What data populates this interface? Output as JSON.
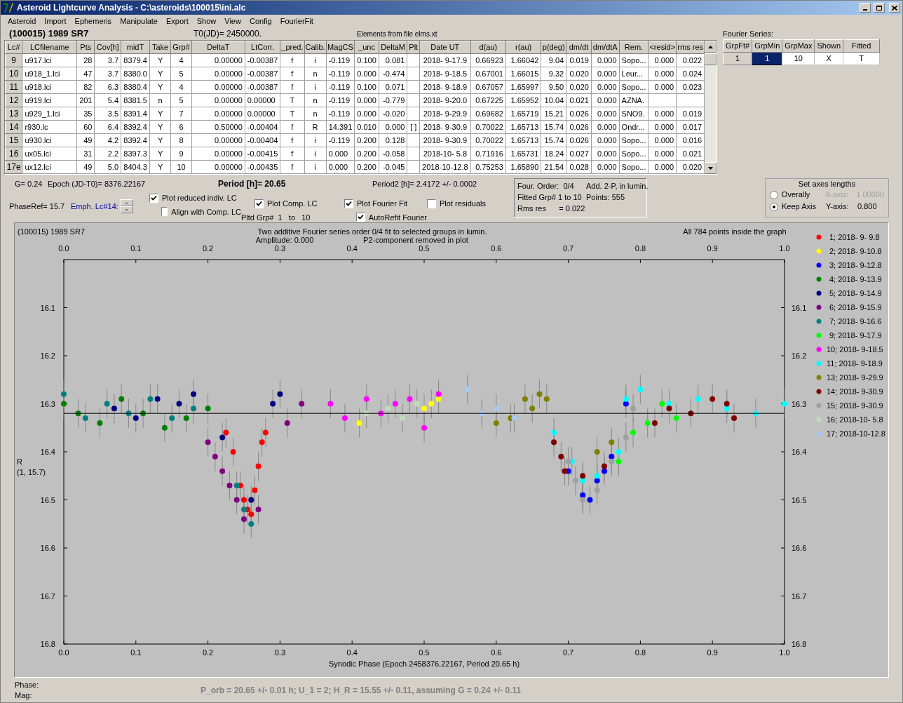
{
  "window": {
    "title": "Asteroid Lightcurve Analysis - C:\\asteroids\\100015\\ini.alc"
  },
  "menu": [
    "Asteroid",
    "Import",
    "Ephemeris",
    "Manipulate",
    "Export",
    "Show",
    "View",
    "Config",
    "FourierFit"
  ],
  "header": {
    "object": "(100015) 1989 SR7",
    "t0": "T0(JD)= 2450000.",
    "elements": "Elements from file elms.xt"
  },
  "table": {
    "columns": [
      "Lc#",
      "LCfilename",
      "Pts",
      "Cov[h]",
      "midT",
      "Take",
      "Grp#",
      "DeltaT",
      "LtCorr.",
      "_pred.",
      "Calib.",
      "MagCS",
      "_unc",
      "DeltaM",
      "Plt",
      "Date UT",
      "d(au)",
      "r(au)",
      "p(deg)",
      "dm/dt",
      "dm/dtA",
      "Rem.",
      "<resid>",
      "rms res"
    ],
    "rows": [
      {
        "cells": [
          "9",
          "u917.lci",
          "28",
          "3.7",
          "8379.4",
          "Y",
          "4",
          "0.00000",
          "-0.00387",
          "f",
          "i",
          "-0.119",
          "0.100",
          "0.081",
          null,
          "2018- 9-17.9",
          "0.66923",
          "1.66042",
          "9.04",
          "0.019",
          "0.000",
          "Sopo...",
          "0.000",
          "0.022"
        ]
      },
      {
        "cells": [
          "10",
          "u918_1.lci",
          "47",
          "3.7",
          "8380.0",
          "Y",
          "5",
          "0.00000",
          "-0.00387",
          "f",
          "n",
          "-0.119",
          "0.000",
          "-0.474",
          null,
          "2018- 9-18.5",
          "0.67001",
          "1.66015",
          "9.32",
          "0.020",
          "0.000",
          "Leur...",
          "0.000",
          "0.024"
        ]
      },
      {
        "cells": [
          "11",
          "u918.lci",
          "82",
          "6.3",
          "8380.4",
          "Y",
          "4",
          "0.00000",
          "-0.00387",
          "f",
          "i",
          "-0.119",
          "0.100",
          "0.071",
          null,
          "2018- 9-18.9",
          "0.67057",
          "1.65997",
          "9.50",
          "0.020",
          "0.000",
          "Sopo...",
          "0.000",
          "0.023"
        ]
      },
      {
        "cells": [
          "12",
          "u919.lci",
          "201",
          "5.4",
          "8381.5",
          "n",
          "5",
          "0.00000",
          "0.00000",
          "T",
          "n",
          "-0.119",
          "0.000",
          "-0.779",
          null,
          "2018- 9-20.0",
          "0.67225",
          "1.65952",
          "10.04",
          "0.021",
          "0.000",
          "AZNA.",
          null,
          null
        ]
      },
      {
        "cells": [
          "13",
          "u929_1.lci",
          "35",
          "3.5",
          "8391.4",
          "Y",
          "7",
          "0.00000",
          "0.00000",
          "T",
          "n",
          "-0.119",
          "0.000",
          "-0.020",
          null,
          "2018- 9-29.9",
          "0.69682",
          "1.65719",
          "15.21",
          "0.026",
          "0.000",
          "SNO9.",
          "0.000",
          "0.019"
        ]
      },
      {
        "cells": [
          "14",
          "r930.lc",
          "60",
          "6.4",
          "8392.4",
          "Y",
          "6",
          "0.50000",
          "-0.00404",
          "f",
          "R",
          "14.391",
          "0.010",
          "0.000",
          "[ ]",
          "2018- 9-30.9",
          "0.70022",
          "1.65713",
          "15.74",
          "0.026",
          "0.000",
          "Ondr...",
          "0.000",
          "0.017"
        ]
      },
      {
        "cells": [
          "15",
          "u930.lci",
          "49",
          "4.2",
          "8392.4",
          "Y",
          "8",
          "0.00000",
          "-0.00404",
          "f",
          "i",
          "-0.119",
          "0.200",
          "0.128",
          null,
          "2018- 9-30.9",
          "0.70022",
          "1.65713",
          "15.74",
          "0.026",
          "0.000",
          "Sopo...",
          "0.000",
          "0.016"
        ]
      },
      {
        "cells": [
          "16",
          "ux05.lci",
          "31",
          "2.2",
          "8397.3",
          "Y",
          "9",
          "0.00000",
          "-0.00415",
          "f",
          "i",
          "0.000",
          "0.200",
          "-0.058",
          null,
          "2018-10- 5.8",
          "0.71916",
          "1.65731",
          "18.24",
          "0.027",
          "0.000",
          "Sopo...",
          "0.000",
          "0.021"
        ]
      },
      {
        "cells": [
          "17e",
          "ux12.lci",
          "49",
          "5.0",
          "8404.3",
          "Y",
          "10",
          "0.00000",
          "-0.00435",
          "f",
          "i",
          "0.000",
          "0.200",
          "-0.045",
          null,
          "2018-10-12.8",
          "0.75253",
          "1.65890",
          "21.54",
          "0.028",
          "0.000",
          "Sopo...",
          "0.000",
          "0.020"
        ]
      }
    ]
  },
  "fourier": {
    "label": "Fourier Series:",
    "columns": [
      "GrpFt#",
      "GrpMin",
      "GrpMax",
      "Shown",
      "Fitted"
    ],
    "row": [
      {
        "text": "1",
        "selected": false
      },
      {
        "text": "1",
        "selected": true
      },
      {
        "text": "10",
        "selected": false
      },
      {
        "text": "X",
        "selected": false
      },
      {
        "text": "T",
        "selected": false
      }
    ]
  },
  "params": {
    "g": "G= 0.24",
    "epoch": "Epoch (JD-T0)= 8376.22167",
    "period": "Period [h]= 20.65",
    "period2": "Period2 [h]= 2.4172 +/- 0.0002",
    "phase_ref": "PhaseRef= 15.7",
    "emph": "Emph. Lc#14:",
    "pltd_grp": "Pltd Grp#  1   to   10"
  },
  "checkboxes": [
    {
      "label": "Plot reduced indiv. LC",
      "checked": true
    },
    {
      "label": "Align with Comp. LC",
      "checked": false
    },
    {
      "label": "Plot Comp. LC",
      "checked": true
    },
    {
      "label": "Plot Fourier Fit",
      "checked": true
    },
    {
      "label": "AutoRefit Fourier",
      "checked": true
    },
    {
      "label": "Plot residuals",
      "checked": false
    }
  ],
  "fit_info": [
    "Four. Order:  0/4",
    "Add. 2-P, in lumin.",
    "Fitted Grp# 1 to 10",
    "Points: 555",
    "Rms res      = 0.022"
  ],
  "axes": {
    "title": "Set axes lengths",
    "options": [
      {
        "label": "Overally",
        "selected": false
      },
      {
        "label": "Keep Axis",
        "selected": true
      }
    ],
    "fields": [
      {
        "label": "X-axis:",
        "value": "1.00000",
        "disabled": true
      },
      {
        "label": "Y-axis:",
        "value": "0.800",
        "disabled": false
      }
    ]
  },
  "plot": {
    "object": "(100015) 1989 SR7",
    "subtitle_left": "Amplitude: 0.000",
    "subtitle_right": "P2-component removed in plot",
    "points_note": "All 784 points inside the graph",
    "y_note": "(1, 15.7)",
    "chart_data": {
      "type": "scatter",
      "title": "Two additive Fourier series order 0/4 fit to selected groups in lumin.",
      "xlabel": "Synodic Phase (Epoch 2458376.22167, Period 20.65 h)",
      "ylabel": "R",
      "xlim": [
        0,
        1
      ],
      "ylim": [
        16.8,
        16.0
      ],
      "xticks": [
        {
          "value": 0,
          "label": "0.0"
        },
        {
          "value": 0.1,
          "label": "0.1"
        },
        {
          "value": 0.2,
          "label": "0.2"
        },
        {
          "value": 0.3,
          "label": "0.3"
        },
        {
          "value": 0.4,
          "label": "0.4"
        },
        {
          "value": 0.5,
          "label": "0.5"
        },
        {
          "value": 0.6,
          "label": "0.6"
        },
        {
          "value": 0.7,
          "label": "0.7"
        },
        {
          "value": 0.8,
          "label": "0.8"
        },
        {
          "value": 0.9,
          "label": "0.9"
        },
        {
          "value": 1,
          "label": "1.0"
        }
      ],
      "yticks": [
        {
          "value": 16.1,
          "label": "16.1"
        },
        {
          "value": 16.2,
          "label": "16.2"
        },
        {
          "value": 16.3,
          "label": "16.3"
        },
        {
          "value": 16.4,
          "label": "16.4"
        },
        {
          "value": 16.5,
          "label": "16.5"
        },
        {
          "value": 16.6,
          "label": "16.6"
        },
        {
          "value": 16.7,
          "label": "16.7"
        },
        {
          "value": 16.8,
          "label": "16.8"
        }
      ],
      "ref_lines": [
        {
          "axis": "y",
          "value": 16.32
        }
      ],
      "legend": true,
      "series": [
        {
          "name": "1; 2018- 9- 9.8",
          "color": "#ff0000",
          "x": [
            0.225,
            0.235,
            0.245,
            0.25,
            0.255,
            0.26,
            0.265,
            0.27,
            0.275,
            0.28
          ],
          "values": [
            16.36,
            16.4,
            16.47,
            16.5,
            16.52,
            16.53,
            16.48,
            16.43,
            16.38,
            16.36
          ],
          "errors": [
            0.03,
            0.03,
            0.03,
            0.03,
            0.03,
            0.03,
            0.03,
            0.03,
            0.03,
            0.03
          ]
        },
        {
          "name": "2; 2018- 9-10.8",
          "color": "#ffff00",
          "x": [
            0.41,
            0.5,
            0.51,
            0.52
          ],
          "values": [
            16.34,
            16.31,
            16.3,
            16.29
          ],
          "errors": [
            0.03,
            0.03,
            0.03,
            0.03
          ]
        },
        {
          "name": "3; 2018- 9-12.8",
          "color": "#0000ff",
          "x": [
            0.7,
            0.72,
            0.73,
            0.74,
            0.75,
            0.76,
            0.78
          ],
          "values": [
            16.44,
            16.49,
            16.5,
            16.46,
            16.44,
            16.41,
            16.3
          ],
          "errors": [
            0.03,
            0.03,
            0.03,
            0.03,
            0.03,
            0.03,
            0.03
          ]
        },
        {
          "name": "4; 2018- 9-13.9",
          "color": "#008000",
          "x": [
            0.0,
            0.02,
            0.05,
            0.08,
            0.11,
            0.14,
            0.17,
            0.2
          ],
          "values": [
            16.3,
            16.32,
            16.34,
            16.29,
            16.32,
            16.35,
            16.33,
            16.31
          ],
          "errors": [
            0.03,
            0.03,
            0.03,
            0.03,
            0.03,
            0.03,
            0.03,
            0.03
          ]
        },
        {
          "name": "5; 2018- 9-14.9",
          "color": "#000080",
          "x": [
            0.07,
            0.1,
            0.13,
            0.16,
            0.18,
            0.22,
            0.26,
            0.29,
            0.3
          ],
          "values": [
            16.31,
            16.33,
            16.29,
            16.3,
            16.28,
            16.37,
            16.5,
            16.3,
            16.28
          ],
          "errors": [
            0.03,
            0.03,
            0.03,
            0.03,
            0.03,
            0.03,
            0.03,
            0.03,
            0.03
          ]
        },
        {
          "name": "6; 2018- 9-15.9",
          "color": "#800080",
          "x": [
            0.2,
            0.21,
            0.22,
            0.23,
            0.24,
            0.25,
            0.27,
            0.31,
            0.33
          ],
          "values": [
            16.38,
            16.41,
            16.44,
            16.47,
            16.5,
            16.54,
            16.52,
            16.34,
            16.3
          ],
          "errors": [
            0.03,
            0.03,
            0.03,
            0.03,
            0.03,
            0.03,
            0.03,
            0.03,
            0.03
          ]
        },
        {
          "name": "7; 2018- 9-16.6",
          "color": "#008080",
          "x": [
            0.0,
            0.03,
            0.06,
            0.09,
            0.12,
            0.15,
            0.18,
            0.24,
            0.25,
            0.26
          ],
          "values": [
            16.28,
            16.33,
            16.3,
            16.32,
            16.29,
            16.33,
            16.31,
            16.47,
            16.52,
            16.55
          ],
          "errors": [
            0.03,
            0.03,
            0.03,
            0.03,
            0.03,
            0.03,
            0.03,
            0.03,
            0.03,
            0.03
          ]
        },
        {
          "name": "9; 2018- 9-17.9",
          "color": "#00ff00",
          "x": [
            0.77,
            0.79,
            0.81,
            0.83,
            0.85
          ],
          "values": [
            16.42,
            16.36,
            16.34,
            16.3,
            16.33
          ],
          "errors": [
            0.03,
            0.03,
            0.03,
            0.03,
            0.03
          ]
        },
        {
          "name": "10; 2018- 9-18.5",
          "color": "#ff00ff",
          "x": [
            0.37,
            0.39,
            0.42,
            0.44,
            0.46,
            0.48,
            0.5,
            0.52
          ],
          "values": [
            16.3,
            16.33,
            16.29,
            16.32,
            16.3,
            16.29,
            16.35,
            16.28
          ],
          "errors": [
            0.03,
            0.03,
            0.03,
            0.03,
            0.03,
            0.03,
            0.03,
            0.03
          ]
        },
        {
          "name": "11; 2018- 9-18.9",
          "color": "#00ffff",
          "x": [
            0.68,
            0.705,
            0.72,
            0.74,
            0.77,
            0.78,
            0.8,
            0.84,
            0.88,
            0.92,
            0.96,
            1.0
          ],
          "values": [
            16.36,
            16.42,
            16.46,
            16.45,
            16.4,
            16.29,
            16.27,
            16.3,
            16.29,
            16.31,
            16.32,
            16.3
          ],
          "errors": [
            0.03,
            0.03,
            0.03,
            0.03,
            0.03,
            0.03,
            0.03,
            0.03,
            0.03,
            0.03,
            0.03,
            0.03
          ]
        },
        {
          "name": "13; 2018- 9-29.9",
          "color": "#808000",
          "x": [
            0.6,
            0.62,
            0.64,
            0.65,
            0.66,
            0.67,
            0.74,
            0.76
          ],
          "values": [
            16.34,
            16.33,
            16.29,
            16.31,
            16.28,
            16.29,
            16.4,
            16.38
          ],
          "errors": [
            0.03,
            0.03,
            0.03,
            0.03,
            0.03,
            0.03,
            0.03,
            0.03
          ]
        },
        {
          "name": "14; 2018- 9-30.9",
          "color": "#800000",
          "x": [
            0.68,
            0.69,
            0.695,
            0.72,
            0.75,
            0.82,
            0.84,
            0.87,
            0.9,
            0.92,
            0.93
          ],
          "values": [
            16.38,
            16.41,
            16.44,
            16.45,
            16.43,
            16.34,
            16.31,
            16.32,
            16.29,
            16.3,
            16.33
          ],
          "errors": [
            0.03,
            0.03,
            0.03,
            0.03,
            0.03,
            0.03,
            0.03,
            0.03,
            0.03,
            0.03,
            0.03
          ]
        },
        {
          "name": "15; 2018- 9-30.9",
          "color": "#a0a0a0",
          "x": [
            0.7,
            0.71,
            0.72,
            0.74,
            0.76,
            0.78,
            0.79
          ],
          "values": [
            16.42,
            16.46,
            16.5,
            16.48,
            16.42,
            16.37,
            16.31
          ],
          "errors": [
            0.03,
            0.03,
            0.03,
            0.03,
            0.03,
            0.03,
            0.03
          ]
        },
        {
          "name": "16; 2018-10- 5.8",
          "color": "#c0dcc0",
          "x": [
            0.42,
            0.45,
            0.47,
            0.49
          ],
          "values": [
            16.32,
            16.31,
            16.33,
            16.3
          ],
          "errors": [
            0.03,
            0.03,
            0.03,
            0.03
          ]
        },
        {
          "name": "17; 2018-10-12.8",
          "color": "#a6caf0",
          "x": [
            0.56,
            0.58,
            0.6,
            0.625
          ],
          "values": [
            16.27,
            16.32,
            16.31,
            16.33
          ],
          "errors": [
            0.03,
            0.03,
            0.03,
            0.03
          ]
        }
      ]
    }
  },
  "footer": {
    "phase_label": "Phase:",
    "mag_label": "Mag:",
    "result": "P_orb = 20.65 +/- 0.01 h; U_1 = 2; H_R = 15.55 +/- 0.11, assuming G = 0.24 +/- 0.11"
  }
}
